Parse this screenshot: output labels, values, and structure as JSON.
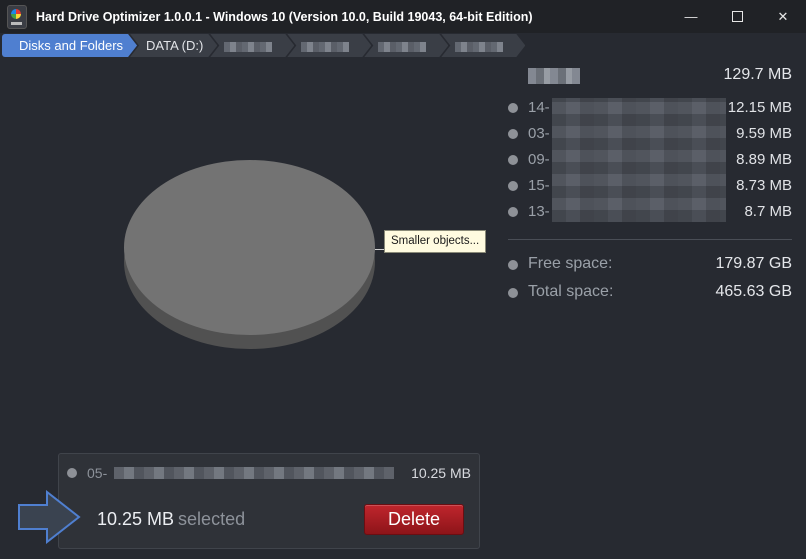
{
  "window": {
    "title": "Hard Drive Optimizer 1.0.0.1 - Windows 10 (Version 10.0, Build 19043, 64-bit Edition)",
    "minimize_glyph": "—",
    "close_glyph": "✕"
  },
  "breadcrumb": {
    "root": "Disks and Folders",
    "drive": "DATA (D:)"
  },
  "chart": {
    "tooltip": "Smaller objects..."
  },
  "panel": {
    "total_size": "129.7 MB",
    "items": [
      {
        "label": "14-",
        "size": "12.15 MB"
      },
      {
        "label": "03-",
        "size": "9.59 MB"
      },
      {
        "label": "09-",
        "size": "8.89 MB"
      },
      {
        "label": "15-",
        "size": "8.73 MB"
      },
      {
        "label": "13-",
        "size": "8.7 MB"
      }
    ],
    "free_label": "Free space:",
    "free_value": "179.87 GB",
    "total_label": "Total space:",
    "total_value": "465.63 GB"
  },
  "selection": {
    "item_label": "05-",
    "item_size": "10.25 MB",
    "amount": "10.25 MB",
    "word": "selected",
    "delete_label": "Delete"
  },
  "colors": {
    "accent": "#4f7fd0",
    "danger": "#b01e24",
    "background": "#272a31"
  }
}
